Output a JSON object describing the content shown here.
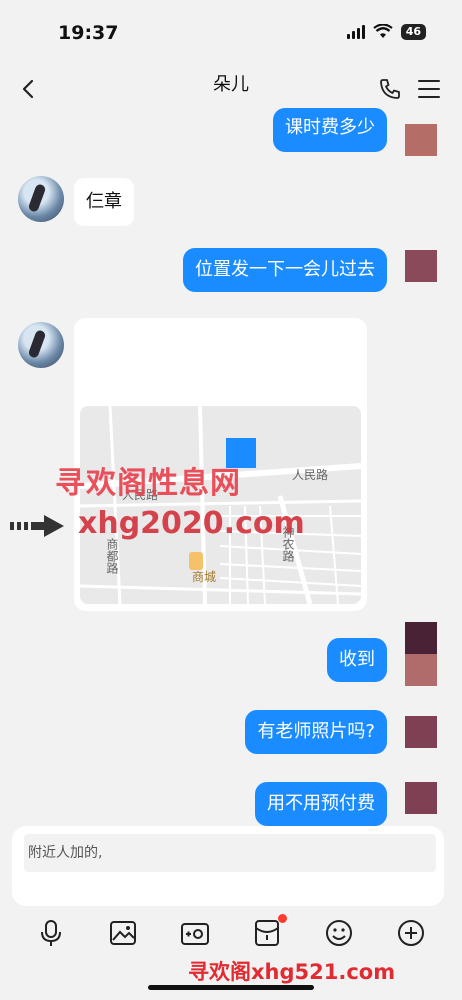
{
  "status_bar": {
    "time": "19:37",
    "battery": "46"
  },
  "nav": {
    "title": "朵儿"
  },
  "messages": [
    {
      "side": "right",
      "text": "课时费多少"
    },
    {
      "side": "left",
      "text": "仨章"
    },
    {
      "side": "right",
      "text": "位置发一下一会儿过去"
    },
    {
      "side": "left",
      "type": "location",
      "map_labels": [
        "人民路",
        "人民路",
        "商都路",
        "神农路",
        "商城"
      ]
    },
    {
      "side": "right",
      "text": "收到"
    },
    {
      "side": "right",
      "text": "有老师照片吗?"
    },
    {
      "side": "right",
      "text": "用不用预付费"
    }
  ],
  "input": {
    "value": "附近人加的,"
  },
  "watermarks": [
    "寻欢阁性息网",
    "xhg2020.com",
    "寻欢阁xhg521.com"
  ],
  "colors": {
    "bubble_right": "#1a8cff",
    "background": "#f2f2f2",
    "watermark": "#e9434e"
  },
  "toolbar_icons": [
    "mic-icon",
    "image-icon",
    "camera-icon",
    "red-packet-icon",
    "emoji-icon",
    "plus-icon"
  ]
}
